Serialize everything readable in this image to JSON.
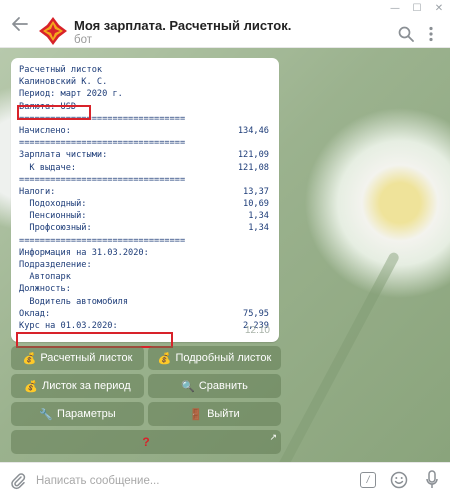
{
  "window": {
    "minimize": "—",
    "maximize": "☐",
    "close": "✕"
  },
  "header": {
    "title": "Моя зарплата. Расчетный листок.",
    "subtitle": "бот"
  },
  "message": {
    "time": "12:10",
    "lines": [
      {
        "l": "Расчетный листок",
        "r": ""
      },
      {
        "l": "Калиновский К. С.",
        "r": ""
      },
      {
        "l": "Период: март 2020 г.",
        "r": ""
      },
      {
        "l": "Валюта: USD",
        "r": ""
      },
      {
        "l": "================================",
        "r": ""
      },
      {
        "l": "Начислено:",
        "r": "134,46"
      },
      {
        "l": "================================",
        "r": ""
      },
      {
        "l": "Зарплата чистыми:",
        "r": "121,09"
      },
      {
        "l": "  К выдаче:",
        "r": "121,08"
      },
      {
        "l": "================================",
        "r": ""
      },
      {
        "l": "Налоги:",
        "r": "13,37"
      },
      {
        "l": "  Подоходный:",
        "r": "10,69"
      },
      {
        "l": "  Пенсионный:",
        "r": "1,34"
      },
      {
        "l": "  Профсоюзный:",
        "r": "1,34"
      },
      {
        "l": "================================",
        "r": ""
      },
      {
        "l": "Информация на 31.03.2020:",
        "r": ""
      },
      {
        "l": "Подразделение:",
        "r": ""
      },
      {
        "l": "  Автопарк",
        "r": ""
      },
      {
        "l": "Должность:",
        "r": ""
      },
      {
        "l": "  Водитель автомобиля",
        "r": ""
      },
      {
        "l": "Оклад:",
        "r": "75,95"
      },
      {
        "l": "Курс на 01.03.2020:",
        "r": "2,239"
      }
    ]
  },
  "keyboard": {
    "rows": [
      [
        {
          "label": "Расчетный листок",
          "icon": "💰",
          "icon_name": "money-bag-icon"
        },
        {
          "label": "Подробный листок",
          "icon": "💰",
          "icon_name": "money-bag-icon"
        }
      ],
      [
        {
          "label": "Листок за период",
          "icon": "💰",
          "icon_name": "money-bag-icon"
        },
        {
          "label": "Сравнить",
          "icon": "🔍",
          "icon_name": "magnifier-icon"
        }
      ],
      [
        {
          "label": "Параметры",
          "icon": "🔧",
          "icon_name": "wrench-icon"
        },
        {
          "label": "Выйти",
          "icon": "🚪",
          "icon_name": "door-icon"
        }
      ],
      [
        {
          "label": "?",
          "icon": "",
          "icon_name": "question-icon",
          "url_arrow": "↗"
        }
      ]
    ]
  },
  "composer": {
    "placeholder": "Написать сообщение...",
    "command_symbol": "/"
  },
  "colors": {
    "highlight": "#d8222a",
    "receipt_text": "#1d3c78",
    "button_bg": "rgba(94,120,80,.5)"
  }
}
